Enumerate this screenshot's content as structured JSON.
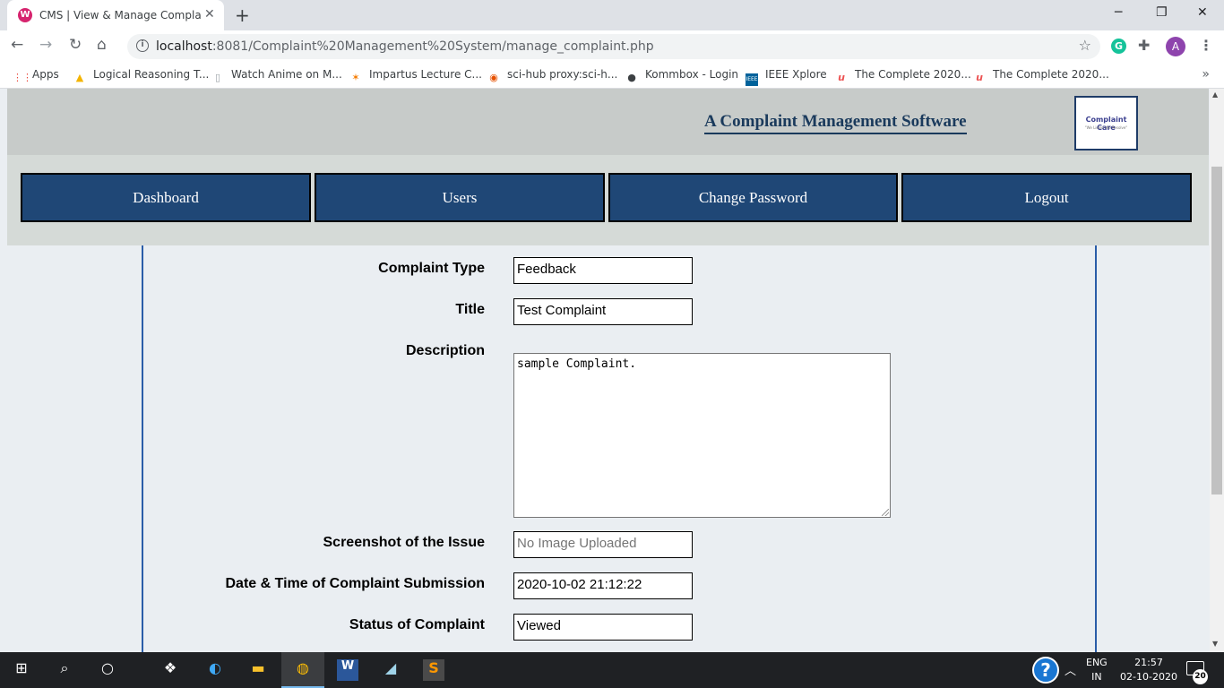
{
  "browser": {
    "tab_title": "CMS | View & Manage Complaint",
    "tab_icon": "wamp-icon",
    "new_tab_symbol": "+",
    "url_host": "localhost",
    "url_rest": ":8081/Complaint%20Management%20System/manage_complaint.php",
    "profile_initial": "A",
    "bookmarks": [
      {
        "label": "Apps",
        "icon": "apps-grid-icon"
      },
      {
        "label": "Logical Reasoning T...",
        "icon": "triangle-logo-icon"
      },
      {
        "label": "Watch Anime on M...",
        "icon": "page-icon"
      },
      {
        "label": "Impartus Lecture C...",
        "icon": "impartus-icon"
      },
      {
        "label": "sci-hub proxy:sci-h...",
        "icon": "eye-icon"
      },
      {
        "label": "Kommbox - Login",
        "icon": "globe-icon"
      },
      {
        "label": "IEEE Xplore",
        "icon": "ieee-icon"
      },
      {
        "label": "The Complete 2020...",
        "icon": "udemy-icon"
      },
      {
        "label": "The Complete 2020...",
        "icon": "udemy-icon"
      }
    ]
  },
  "site": {
    "title": "A Complaint Management Software",
    "logo_text": "Complaint Care",
    "logo_tagline": "\"We Listen We Resolve\"",
    "nav": [
      "Dashboard",
      "Users",
      "Change Password",
      "Logout"
    ]
  },
  "form": {
    "complaint_type": {
      "label": "Complaint Type",
      "value": "Feedback"
    },
    "title": {
      "label": "Title",
      "value": "Test Complaint"
    },
    "description": {
      "label": "Description",
      "value": "sample Complaint."
    },
    "screenshot": {
      "label": "Screenshot of the Issue",
      "placeholder": "No Image Uploaded"
    },
    "datetime": {
      "label": "Date & Time of Complaint Submission",
      "value": "2020-10-02 21:12:22"
    },
    "status": {
      "label": "Status of Complaint",
      "value": "Viewed"
    }
  },
  "taskbar": {
    "lang_top": "ENG",
    "lang_bottom": "IN",
    "time": "21:57",
    "date": "02-10-2020",
    "notification_count": "20"
  }
}
